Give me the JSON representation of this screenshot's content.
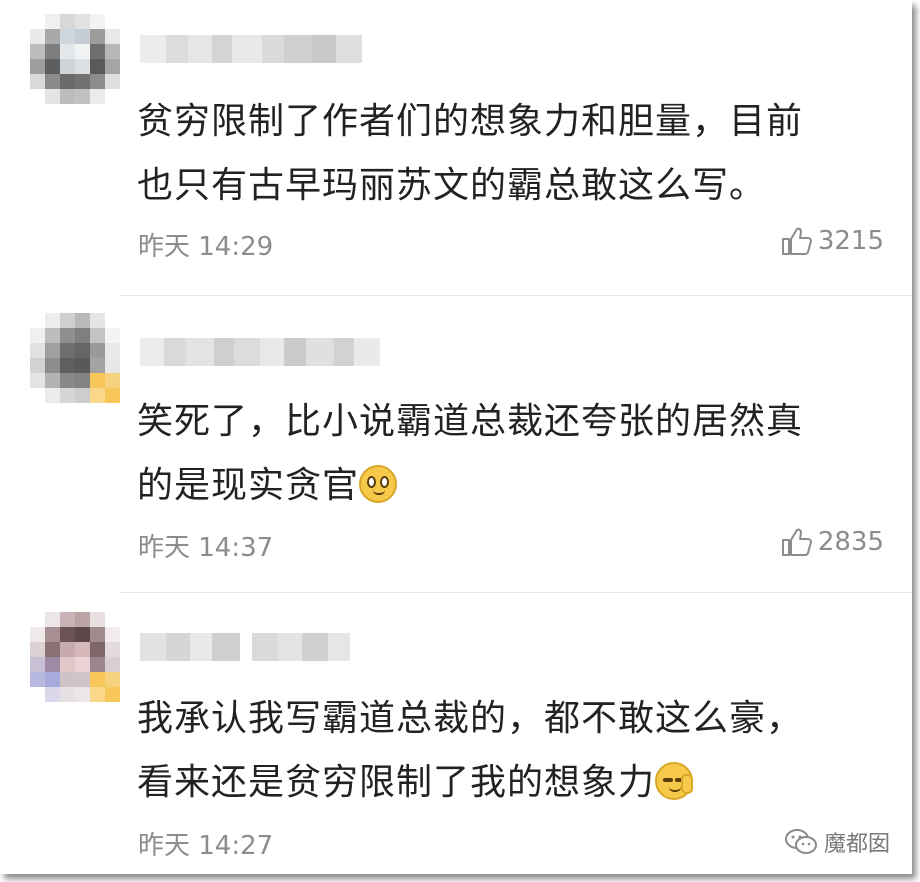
{
  "comments": [
    {
      "text_line1": "贫穷限制了作者们的想象力和胆量，目前",
      "text_line2": "也只有古早玛丽苏文的霸总敢这么写。",
      "time": "昨天 14:29",
      "likes": "3215",
      "emoji": ""
    },
    {
      "text_line1": "笑死了，比小说霸道总裁还夸张的居然真",
      "text_line2": "的是现实贪官",
      "time": "昨天 14:37",
      "likes": "2835",
      "emoji": "smile-emoji"
    },
    {
      "text_line1": "我承认我写霸道总裁的，都不敢这么豪，",
      "text_line2": "看来还是贫穷限制了我的想象力",
      "time": "昨天 14:27",
      "likes": "",
      "emoji": "sleepy-emoji"
    }
  ],
  "watermark": {
    "label": "魔都囡",
    "icon": "wechat-icon"
  },
  "colors": {
    "text": "#222222",
    "meta": "#8c8c8c",
    "divider": "#e6e6e6",
    "avatar_badge": "#f7c75a"
  }
}
